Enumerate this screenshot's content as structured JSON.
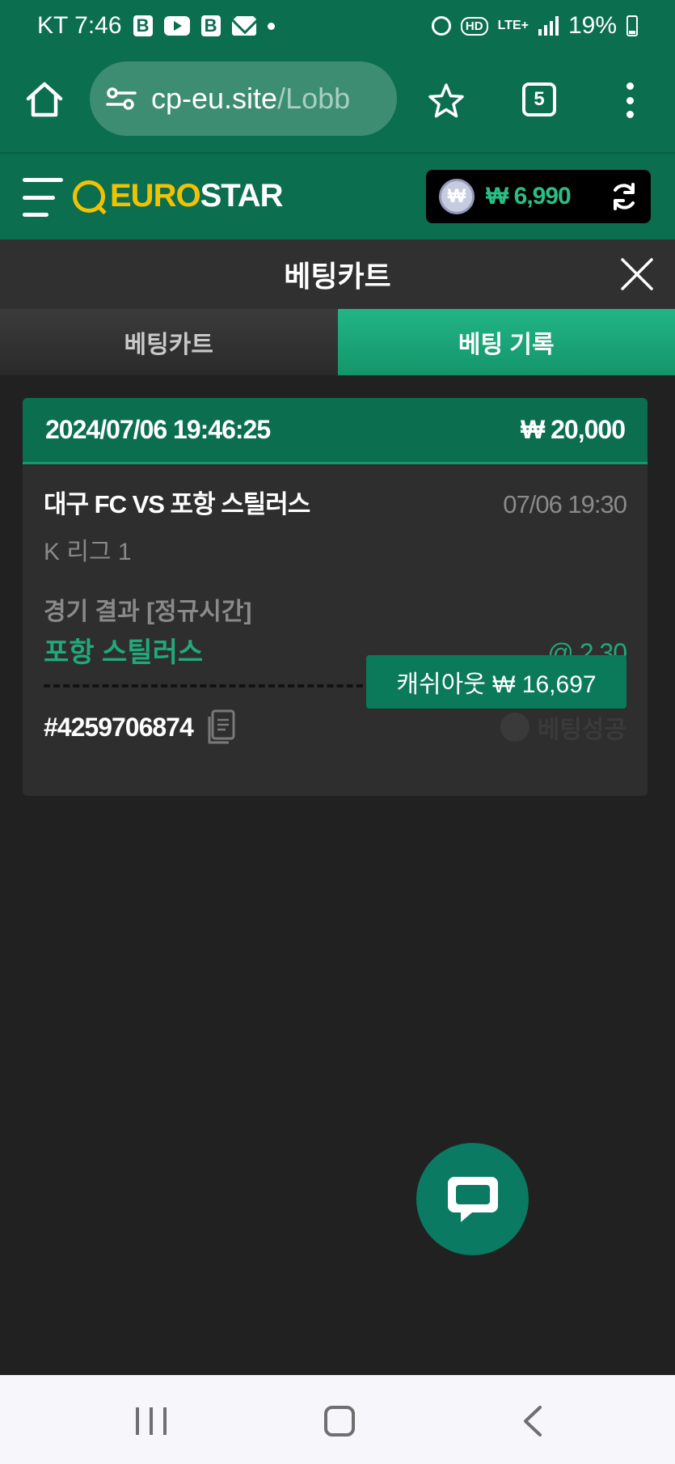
{
  "status_bar": {
    "carrier_time": "KT 7:46",
    "network": "LTE+",
    "hd_label": "HD",
    "battery": "19%",
    "icons": [
      "b-app-icon",
      "youtube-icon",
      "b-app-icon",
      "mail-icon",
      "notification-dot",
      "alarm-icon",
      "hd-voice-icon",
      "signal-icon",
      "battery-icon"
    ]
  },
  "browser": {
    "url_host": "cp-eu.site",
    "url_path": "/Lobb",
    "tab_count": "5"
  },
  "site_header": {
    "logo_euro": "EURO",
    "logo_star": "STAR",
    "currency_symbol": "₩",
    "balance": "₩ 6,990"
  },
  "bet_panel": {
    "title": "베팅카트",
    "tabs": [
      {
        "label": "베팅카트",
        "active": false
      },
      {
        "label": "베팅 기록",
        "active": true
      }
    ]
  },
  "bet_record": {
    "placed_at": "2024/07/06 19:46:25",
    "stake": "₩ 20,000",
    "match": "대구 FC VS 포항 스틸러스",
    "match_time": "07/06 19:30",
    "league": "K 리그 1",
    "market": "경기 결과 [정규시간]",
    "pick": "포항 스틸러스",
    "odds": "@ 2.30",
    "ticket_id": "#4259706874",
    "status": "베팅성공",
    "cashout_label": "캐쉬아웃 ₩ 16,697"
  },
  "colors": {
    "brand_green": "#0b6e4f",
    "accent_green": "#20a97a",
    "logo_yellow": "#f2c200",
    "background": "#212121"
  }
}
